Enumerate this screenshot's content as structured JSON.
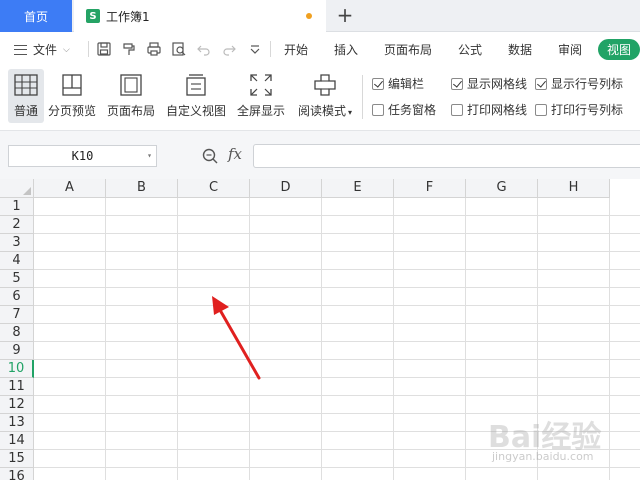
{
  "tabs": {
    "home": "首页",
    "doc_icon": "S",
    "doc_title": "工作簿1",
    "new_tab": "+"
  },
  "menu": {
    "file": "文件",
    "tabs": [
      "开始",
      "插入",
      "页面布局",
      "公式",
      "数据",
      "审阅"
    ],
    "active_tab": "视图"
  },
  "ribbon": {
    "buttons": [
      "普通",
      "分页预览",
      "页面布局",
      "自定义视图",
      "全屏显示",
      "阅读模式"
    ],
    "checkboxes": [
      {
        "label": "编辑栏",
        "checked": true
      },
      {
        "label": "显示网格线",
        "checked": true
      },
      {
        "label": "显示行号列标",
        "checked": true
      },
      {
        "label": "任务窗格",
        "checked": false
      },
      {
        "label": "打印网格线",
        "checked": false
      },
      {
        "label": "打印行号列标",
        "checked": false
      }
    ]
  },
  "formula_bar": {
    "cell_ref": "K10",
    "fx": "fx",
    "formula": ""
  },
  "sheet": {
    "columns": [
      "A",
      "B",
      "C",
      "D",
      "E",
      "F",
      "G",
      "H"
    ],
    "rows": [
      "1",
      "2",
      "3",
      "4",
      "5",
      "6",
      "7",
      "8",
      "9",
      "10",
      "11",
      "12",
      "13",
      "14",
      "15",
      "16"
    ],
    "selected_row": "10"
  },
  "watermark": {
    "main": "Bai经验",
    "sub": "jingyan.baidu.com"
  },
  "colors": {
    "home_tab": "#3d7cf5",
    "accent_green": "#21a366",
    "arrow_red": "#e0201f"
  }
}
